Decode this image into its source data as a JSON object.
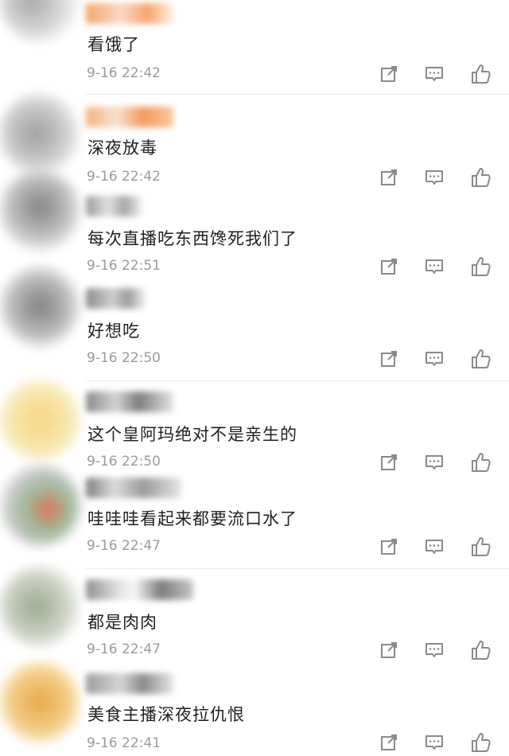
{
  "comments": [
    {
      "text": "看饿了",
      "time": "9-16 22:42"
    },
    {
      "text": "深夜放毒",
      "time": "9-16 22:42"
    },
    {
      "text": "每次直播吃东西馋死我们了",
      "time": "9-16 22:51"
    },
    {
      "text": "好想吃",
      "time": "9-16 22:50"
    },
    {
      "text": "这个皇阿玛绝对不是亲生的",
      "time": "9-16 22:50"
    },
    {
      "text": "哇哇哇看起来都要流口水了",
      "time": "9-16 22:47"
    },
    {
      "text": "都是肉肉",
      "time": "9-16 22:47"
    },
    {
      "text": "美食主播深夜拉仇恨",
      "time": "9-16 22:41"
    }
  ],
  "colors": {
    "text": "#1f1f1f",
    "timestamp": "#9b9b9b",
    "icon": "#8a8a8a",
    "divider": "#ececec"
  },
  "icons": [
    "share-icon",
    "comment-icon",
    "like-icon"
  ]
}
